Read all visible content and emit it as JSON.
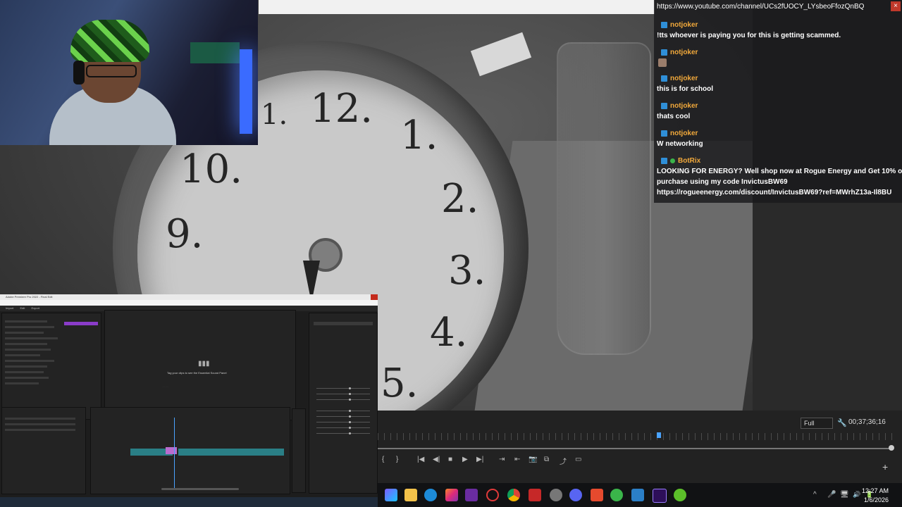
{
  "chat": {
    "channel_url": "https://www.youtube.com/channel/UCs2fUOCY_LYsbeoFfozQnBQ",
    "close_label": "×",
    "messages": [
      {
        "user": "notjoker",
        "text": "!tts whoever is paying you for this is getting scammed."
      },
      {
        "user": "notjoker",
        "text": ""
      },
      {
        "user": "notjoker",
        "text": "this is for school"
      },
      {
        "user": "notjoker",
        "text": "thats cool"
      },
      {
        "user": "notjoker",
        "text": "W networking"
      },
      {
        "user": "BotRix",
        "text_line1": "LOOKING FOR ENERGY? Well shop now at Rogue Energy and Get 10% off your",
        "text_line2": "purchase using my code InvictusBW69",
        "text_line3": "https://rogueenergy.com/discount/InvictusBW69?ref=MWrhZ13a-Il8BU"
      }
    ]
  },
  "clock": {
    "numbers": [
      "12.",
      "1.",
      "1.",
      "2.",
      "10.",
      "9.",
      "3.",
      "4.",
      "5."
    ]
  },
  "program_monitor": {
    "quality": "Full",
    "wrench_icon": "🔧",
    "timecode": "00;37;36;16",
    "controls": [
      "{",
      "}",
      "|◀",
      "◀|",
      "■",
      "▶",
      "▶|",
      "⇥",
      "⇤",
      "📷",
      "⧉",
      "⤴",
      "▭"
    ],
    "add_label": "+"
  },
  "premiere": {
    "title": "Adobe Premiere Pro 2022 - Final Edit",
    "tabs": [
      "Import",
      "Edit",
      "Export"
    ],
    "essential_sound_text": "Tag your clips to see the Essential Sound Panel"
  },
  "taskbar": {
    "time": "12:27 AM",
    "date": "1/6/2026",
    "tray_icons": [
      "^",
      "🎤",
      "🖥",
      "🔊",
      "🔋"
    ]
  },
  "colors": {
    "chat_user": "#f2a93b",
    "accent_blue": "#4aa3ff",
    "close_red": "#c0392b"
  }
}
